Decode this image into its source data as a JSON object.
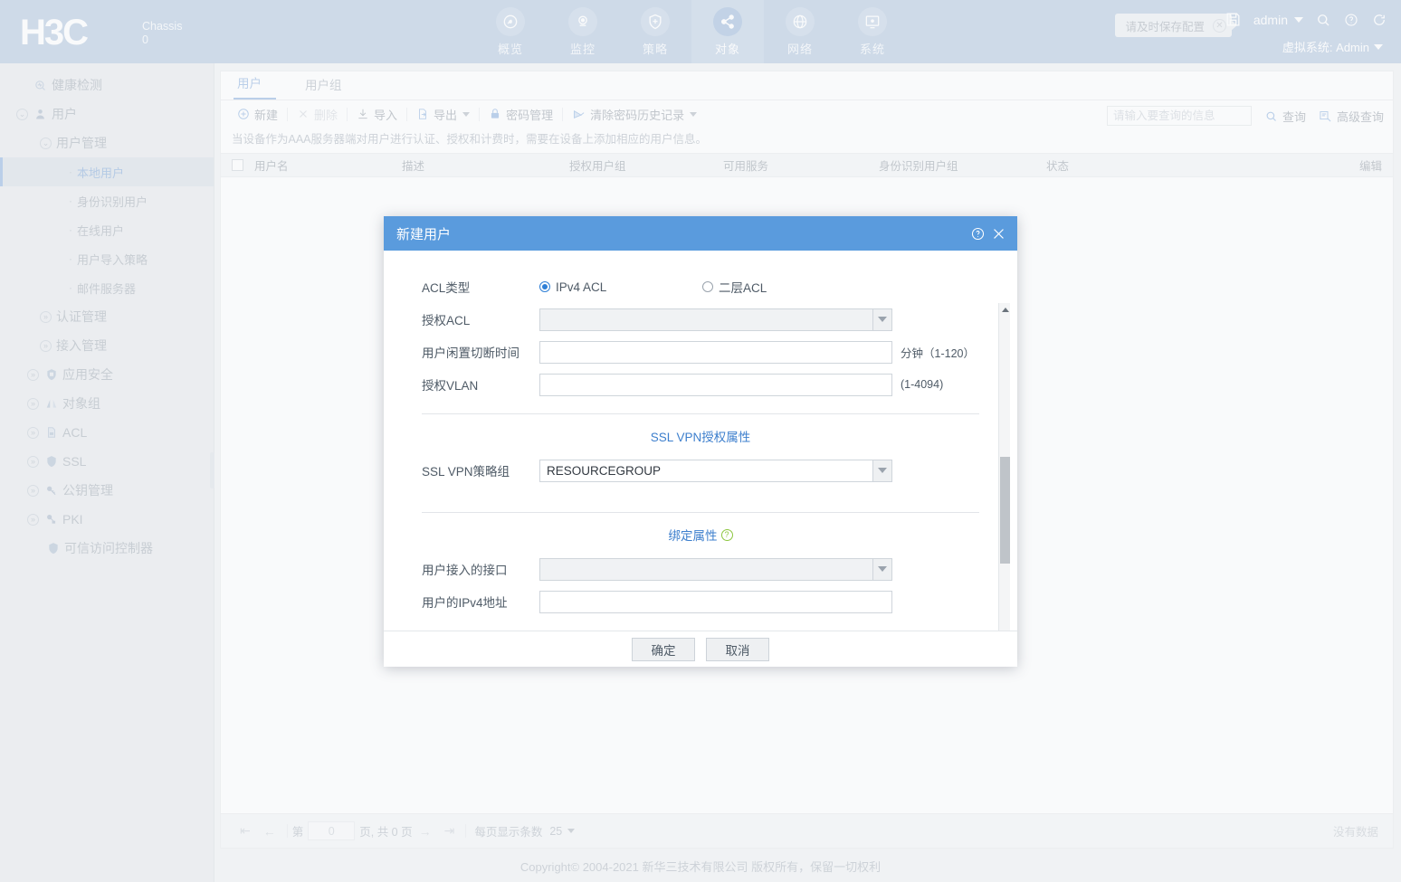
{
  "header": {
    "logo": "H3C",
    "chassis_label": "Chassis",
    "chassis_value": "0",
    "save_tip": "请及时保存配置",
    "admin": "admin",
    "vsys": "虚拟系统: Admin",
    "nav": [
      {
        "label": "概览",
        "icon": "gauge-icon",
        "active": false
      },
      {
        "label": "监控",
        "icon": "monitor-icon",
        "active": false
      },
      {
        "label": "策略",
        "icon": "shield-plus-icon",
        "active": false
      },
      {
        "label": "对象",
        "icon": "share-nodes-icon",
        "active": true
      },
      {
        "label": "网络",
        "icon": "globe-icon",
        "active": false
      },
      {
        "label": "系统",
        "icon": "system-gear-icon",
        "active": false
      }
    ]
  },
  "sidebar": {
    "items": [
      {
        "label": "健康检测",
        "level": 0,
        "icon": "health-icon",
        "expand": "",
        "selected": false
      },
      {
        "label": "用户",
        "level": 0,
        "icon": "user-icon",
        "expand": "⌄",
        "selected": false
      },
      {
        "label": "用户管理",
        "level": 1,
        "icon": "",
        "expand": "⌄",
        "selected": false
      },
      {
        "label": "本地用户",
        "level": 3,
        "icon": "",
        "expand": "",
        "selected": true
      },
      {
        "label": "身份识别用户",
        "level": 3,
        "icon": "",
        "expand": "",
        "selected": false
      },
      {
        "label": "在线用户",
        "level": 3,
        "icon": "",
        "expand": "",
        "selected": false
      },
      {
        "label": "用户导入策略",
        "level": 3,
        "icon": "",
        "expand": "",
        "selected": false
      },
      {
        "label": "邮件服务器",
        "level": 3,
        "icon": "",
        "expand": "",
        "selected": false
      },
      {
        "label": "认证管理",
        "level": 1,
        "icon": "",
        "expand": "»",
        "selected": false
      },
      {
        "label": "接入管理",
        "level": 1,
        "icon": "",
        "expand": "»",
        "selected": false
      },
      {
        "label": "应用安全",
        "level": 0,
        "icon": "app-shield-icon",
        "expand": "»",
        "selected": false
      },
      {
        "label": "对象组",
        "level": 0,
        "icon": "object-group-icon",
        "expand": "»",
        "selected": false
      },
      {
        "label": "ACL",
        "level": 0,
        "icon": "acl-doc-icon",
        "expand": "»",
        "selected": false
      },
      {
        "label": "SSL",
        "level": 0,
        "icon": "ssl-shield-icon",
        "expand": "»",
        "selected": false
      },
      {
        "label": "公钥管理",
        "level": 0,
        "icon": "key-icon",
        "expand": "»",
        "selected": false
      },
      {
        "label": "PKI",
        "level": 0,
        "icon": "pki-key-icon",
        "expand": "»",
        "selected": false
      },
      {
        "label": "可信访问控制器",
        "level": 0,
        "icon": "trust-shield-icon",
        "expand": "",
        "selected": false
      }
    ]
  },
  "main": {
    "tabs": [
      {
        "label": "用户",
        "active": true
      },
      {
        "label": "用户组",
        "active": false
      }
    ],
    "toolbar": [
      {
        "label": "新建",
        "icon": "plus-circle-icon",
        "disabled": false,
        "caret": false
      },
      {
        "label": "删除",
        "icon": "cross-icon",
        "disabled": true,
        "caret": false
      },
      {
        "label": "导入",
        "icon": "import-icon",
        "disabled": false,
        "caret": false
      },
      {
        "label": "导出",
        "icon": "export-icon",
        "disabled": false,
        "caret": true
      },
      {
        "label": "密码管理",
        "icon": "lock-icon",
        "disabled": false,
        "caret": false
      },
      {
        "label": "清除密码历史记录",
        "icon": "eraser-icon",
        "disabled": false,
        "caret": true
      }
    ],
    "search": {
      "placeholder": "请输入要查询的信息",
      "value": "",
      "query_label": "查询",
      "advanced_label": "高级查询"
    },
    "hint": "当设备作为AAA服务器端对用户进行认证、授权和计费时，需要在设备上添加相应的用户信息。",
    "columns": [
      "用户名",
      "描述",
      "授权用户组",
      "可用服务",
      "身份识别用户组",
      "状态",
      "编辑"
    ],
    "rows": [],
    "pager": {
      "page_prefix": "第",
      "page_value": "0",
      "page_suffix": "页, 共 0 页",
      "per_page_label": "每页显示条数",
      "per_page_value": "25",
      "no_data": "没有数据"
    }
  },
  "modal": {
    "title": "新建用户",
    "acl_type_label": "ACL类型",
    "acl_type_options": [
      {
        "label": "IPv4 ACL",
        "checked": true
      },
      {
        "label": "二层ACL",
        "checked": false
      }
    ],
    "auth_acl_label": "授权ACL",
    "auth_acl_value": "",
    "idle_cut_label": "用户闲置切断时间",
    "idle_cut_value": "",
    "idle_cut_unit": "分钟（1-120）",
    "vlan_label": "授权VLAN",
    "vlan_value": "",
    "vlan_unit": "(1-4094)",
    "sslvpn_section": "SSL VPN授权属性",
    "sslvpn_group_label": "SSL VPN策略组",
    "sslvpn_group_value": "RESOURCEGROUP",
    "bind_section": "绑定属性",
    "bind_iface_label": "用户接入的接口",
    "bind_iface_value": "",
    "bind_ipv4_label": "用户的IPv4地址",
    "bind_ipv4_value": "",
    "ok_label": "确定",
    "cancel_label": "取消"
  },
  "footer": {
    "copyright": "Copyright© 2004-2021 新华三技术有限公司 版权所有，保留一切权利"
  },
  "colors": {
    "header_bg": "#8fabcd",
    "accent": "#5b8fd0",
    "modal_head": "#5a9bdd",
    "sidebar_bg": "#d9dde2"
  }
}
